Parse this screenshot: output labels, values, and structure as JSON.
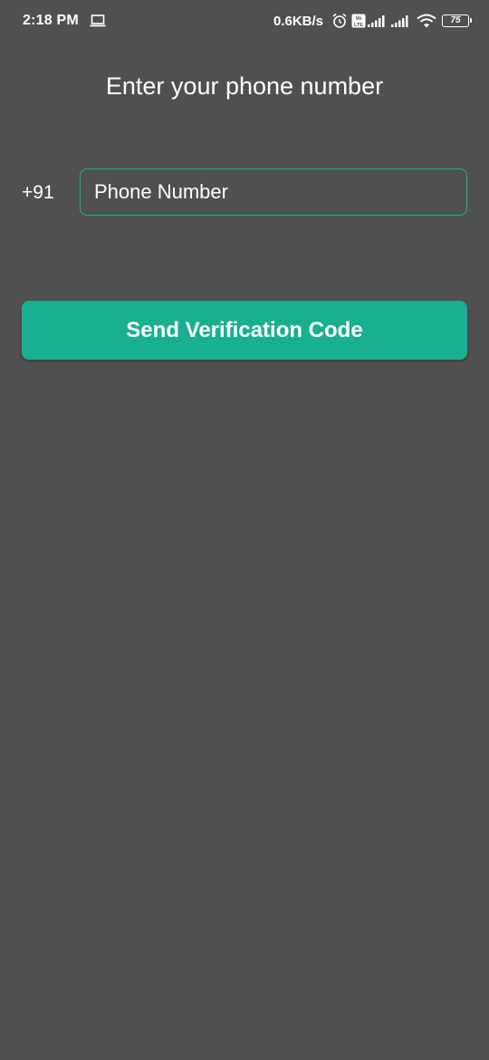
{
  "status_bar": {
    "time": "2:18 PM",
    "net_speed": "0.6KB/s",
    "battery_level": "75",
    "volte_label": "Vo LTE",
    "icons": [
      "laptop-icon",
      "alarm-icon",
      "volte-icon",
      "signal-icon",
      "signal-icon",
      "wifi-icon",
      "battery-icon"
    ]
  },
  "main": {
    "title": "Enter your phone number",
    "country_code": "+91",
    "phone_input": {
      "value": "",
      "placeholder": "Phone Number"
    },
    "send_button_label": "Send Verification Code"
  },
  "colors": {
    "background": "#505050",
    "accent": "#19b08f",
    "text": "#ffffff"
  }
}
